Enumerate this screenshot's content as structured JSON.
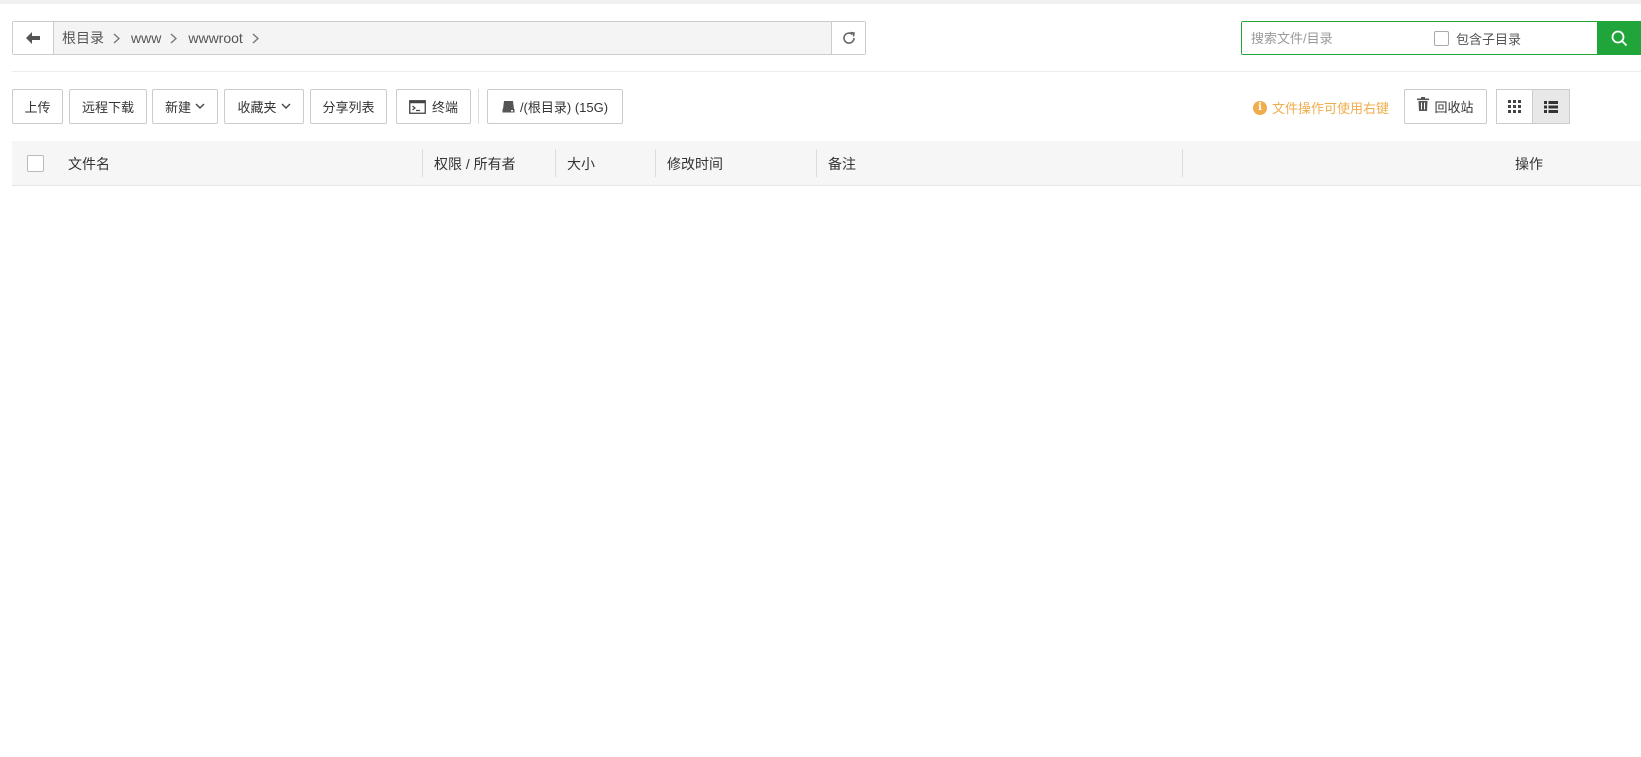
{
  "path": {
    "crumbs": [
      "根目录",
      "www",
      "wwwroot"
    ]
  },
  "search": {
    "placeholder": "搜索文件/目录",
    "include_sub_label": "包含子目录"
  },
  "toolbar": {
    "upload": "上传",
    "remote_download": "远程下载",
    "new": "新建",
    "favorites": "收藏夹",
    "share_list": "分享列表",
    "terminal": "终端",
    "disk": "/(根目录) (15G)",
    "tip": "文件操作可使用右键",
    "recycle": "回收站"
  },
  "table": {
    "columns": [
      "文件名",
      "权限 / 所有者",
      "大小",
      "修改时间",
      "备注",
      "操作"
    ]
  },
  "colors": {
    "accent": "#20a53a",
    "tip": "#f0ad4e"
  }
}
